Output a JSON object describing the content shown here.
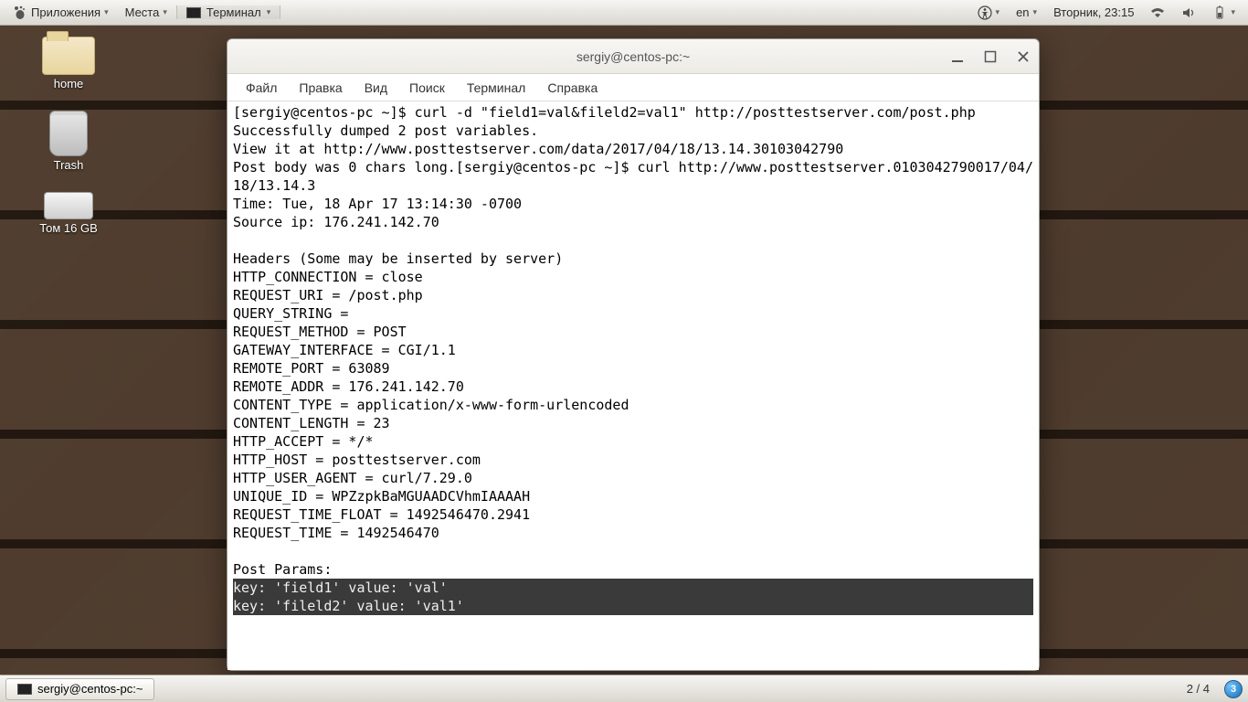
{
  "panel": {
    "apps_label": "Приложения",
    "places_label": "Места",
    "running_app": "Терминал",
    "lang": "en",
    "clock": "Вторник, 23:15"
  },
  "desktop": {
    "home": "home",
    "trash": "Trash",
    "disk": "Том 16 GB"
  },
  "window": {
    "title": "sergiy@centos-pc:~",
    "menu": {
      "file": "Файл",
      "edit": "Правка",
      "view": "Вид",
      "search": "Поиск",
      "terminal": "Терминал",
      "help": "Справка"
    }
  },
  "terminal": {
    "body": "[sergiy@centos-pc ~]$ curl -d \"field1=val&fileld2=val1\" http://posttestserver.com/post.php\nSuccessfully dumped 2 post variables.\nView it at http://www.posttestserver.com/data/2017/04/18/13.14.30103042790\nPost body was 0 chars long.[sergiy@centos-pc ~]$ curl http://www.posttestserver.0103042790017/04/18/13.14.3\nTime: Tue, 18 Apr 17 13:14:30 -0700\nSource ip: 176.241.142.70\n\nHeaders (Some may be inserted by server)\nHTTP_CONNECTION = close\nREQUEST_URI = /post.php\nQUERY_STRING = \nREQUEST_METHOD = POST\nGATEWAY_INTERFACE = CGI/1.1\nREMOTE_PORT = 63089\nREMOTE_ADDR = 176.241.142.70\nCONTENT_TYPE = application/x-www-form-urlencoded\nCONTENT_LENGTH = 23\nHTTP_ACCEPT = */*\nHTTP_HOST = posttestserver.com\nHTTP_USER_AGENT = curl/7.29.0\nUNIQUE_ID = WPZzpkBaMGUAADCVhmIAAAAH\nREQUEST_TIME_FLOAT = 1492546470.2941\nREQUEST_TIME = 1492546470\n\nPost Params:",
    "sel1": "key: 'field1' value: 'val'",
    "sel2": "key: 'fileld2' value: 'val1'"
  },
  "taskbar": {
    "task": "sergiy@centos-pc:~",
    "workspace": "2 / 4",
    "badge": "3"
  }
}
